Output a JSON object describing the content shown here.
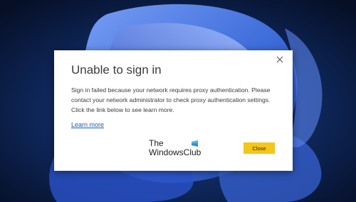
{
  "dialog": {
    "title": "Unable to sign in",
    "message": "Sign in failed because your network requires proxy authentication. Please contact your network administrator to check proxy authentication settings. Click the link below to see learn more.",
    "link_label": "Learn more",
    "close_button_label": "Close",
    "close_icon": "close-icon"
  },
  "watermark": {
    "line1": "The",
    "line2": "WindowsClub"
  },
  "colors": {
    "accent_button": "#f5c518",
    "link": "#1a5fb4",
    "wallpaper_dark": "#0a1b3a",
    "wallpaper_bloom": "#3f6fe0"
  }
}
